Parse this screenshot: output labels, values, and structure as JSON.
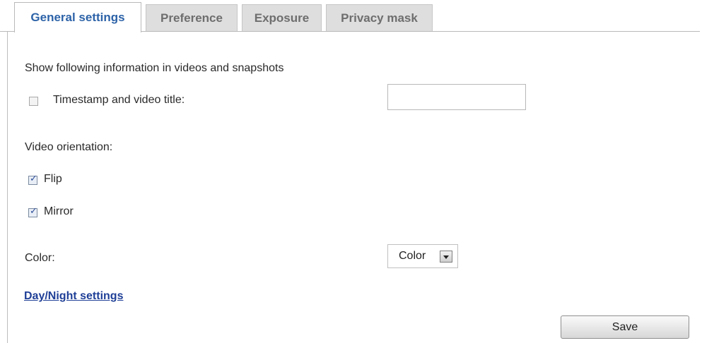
{
  "tabs": [
    {
      "label": "General settings",
      "active": true
    },
    {
      "label": "Preference",
      "active": false
    },
    {
      "label": "Exposure",
      "active": false
    },
    {
      "label": "Privacy mask",
      "active": false
    }
  ],
  "info_section": {
    "heading": "Show following information in videos and snapshots",
    "timestamp_label": "Timestamp and video title:",
    "timestamp_checked": false,
    "title_value": ""
  },
  "orientation": {
    "heading": "Video orientation:",
    "flip_label": "Flip",
    "flip_checked": true,
    "mirror_label": "Mirror",
    "mirror_checked": true
  },
  "color": {
    "label": "Color:",
    "selected": "Color"
  },
  "links": {
    "day_night": "Day/Night settings"
  },
  "buttons": {
    "save": "Save"
  },
  "colors": {
    "active_tab_text": "#2d63a8",
    "inactive_tab_bg": "#dedede",
    "link": "#1f3f97"
  }
}
